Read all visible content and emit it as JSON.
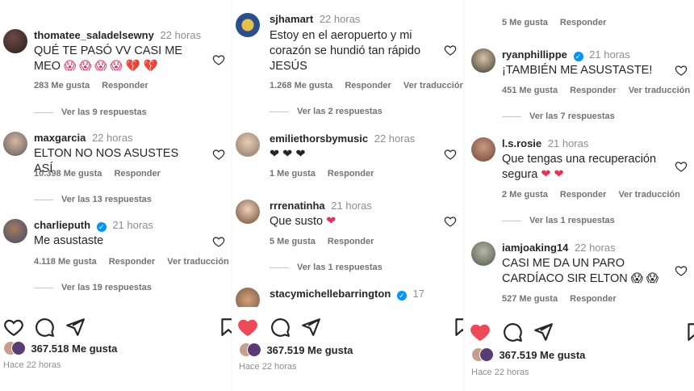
{
  "panel1": {
    "comments": [
      {
        "user": "thomatee_saladelsewny",
        "time": "22 horas",
        "verified": false,
        "text": "QUÉ TE PASÓ VV CASI ME MEO",
        "emoji": "😱 😱 😱 😱 💔 💔",
        "likes": "283 Me gusta",
        "reply": "Responder",
        "translate": "",
        "replies": "Ver las 9 respuestas"
      },
      {
        "user": "maxgarcia",
        "time": "22 horas",
        "verified": false,
        "text": "ELTON NO NOS ASUSTES ASÍ",
        "emoji": "",
        "likes": "10.398 Me gusta",
        "reply": "Responder",
        "translate": "",
        "replies": "Ver las 13 respuestas"
      },
      {
        "user": "charlieputh",
        "time": "21 horas",
        "verified": true,
        "text": "Me asustaste",
        "emoji": "",
        "likes": "4.118 Me gusta",
        "reply": "Responder",
        "translate": "Ver traducción",
        "replies": "Ver las 19 respuestas"
      }
    ],
    "like_count": "367.518 Me gusta",
    "ago": "Hace 22 horas",
    "liked": false
  },
  "panel2": {
    "comments": [
      {
        "user": "sjhamart",
        "time": "22 horas",
        "verified": false,
        "text": "Estoy en el aeropuerto y mi corazón se hundió tan rápido JESÚS",
        "emoji": "",
        "likes": "1.268 Me gusta",
        "reply": "Responder",
        "translate": "Ver traducción",
        "replies": "Ver las 2 respuestas"
      },
      {
        "user": "emiliethorsbymusic",
        "time": "22 horas",
        "verified": false,
        "text": "",
        "emoji": "❤ ❤ ❤",
        "likes": "1 Me gusta",
        "reply": "Responder",
        "translate": "",
        "replies": ""
      },
      {
        "user": "rrrenatinha",
        "time": "21 horas",
        "verified": false,
        "text": "Que susto",
        "emoji": "❤",
        "likes": "5 Me gusta",
        "reply": "Responder",
        "translate": "",
        "replies": "Ver las 1 respuestas"
      },
      {
        "user": "stacymichellebarrington",
        "time": "17",
        "verified": true,
        "text": "",
        "emoji": "",
        "likes": "",
        "reply": "",
        "translate": "",
        "replies": ""
      }
    ],
    "like_count": "367.519 Me gusta",
    "ago": "Hace 22 horas",
    "liked": true
  },
  "panel3": {
    "top_meta": {
      "likes": "5 Me gusta",
      "reply": "Responder"
    },
    "comments": [
      {
        "user": "ryanphillippe",
        "time": "21 horas",
        "verified": true,
        "text": "¡TAMBIÉN ME ASUSTASTE!",
        "emoji": "",
        "likes": "451 Me gusta",
        "reply": "Responder",
        "translate": "Ver traducción",
        "replies": "Ver las 7 respuestas"
      },
      {
        "user": "l.s.rosie",
        "time": "21 horas",
        "verified": false,
        "text": "Que tengas una recuperación segura",
        "emoji": "❤ ❤",
        "likes": "2 Me gusta",
        "reply": "Responder",
        "translate": "Ver traducción",
        "replies": "Ver las 1 respuestas"
      },
      {
        "user": "iamjoaking14",
        "time": "22 horas",
        "verified": false,
        "text": "CASI ME DA UN PARO CARDÍACO SIR ELTON",
        "emoji": "😱 😱",
        "likes": "527 Me gusta",
        "reply": "Responder",
        "translate": "",
        "replies": ""
      }
    ],
    "like_count": "367.519 Me gusta",
    "ago": "Hace 22 horas",
    "liked": true
  },
  "icons": {
    "like": "heart-icon",
    "comment": "comment-icon",
    "share": "send-icon",
    "save": "bookmark-icon"
  },
  "colors": {
    "liked_red": "#ed4956",
    "username": "#262626",
    "muted": "#737373",
    "verified": "#0095f6"
  }
}
